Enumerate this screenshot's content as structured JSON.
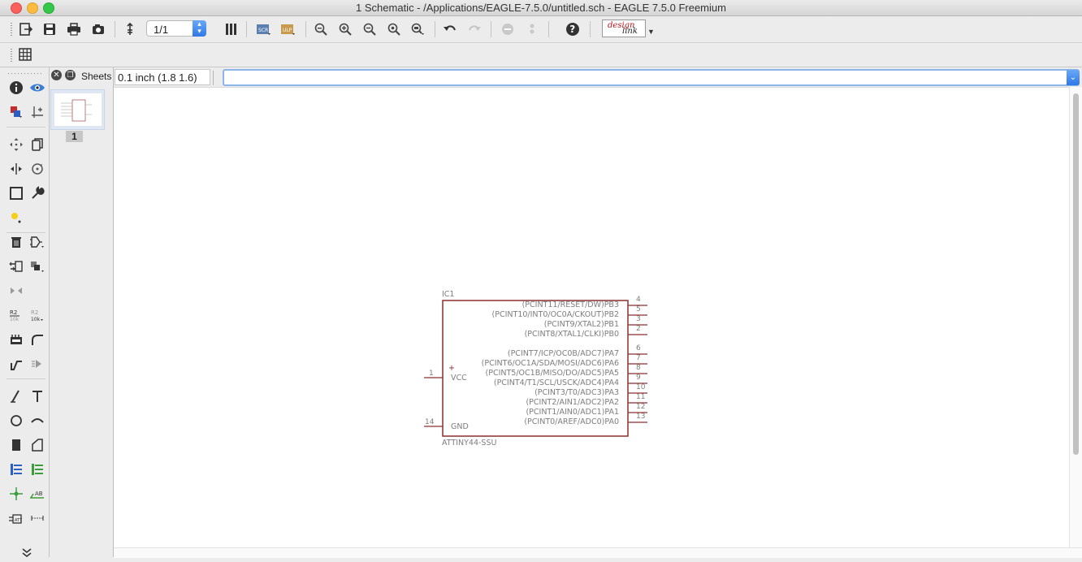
{
  "window": {
    "title": "1 Schematic - /Applications/EAGLE-7.5.0/untitled.sch - EAGLE 7.5.0 Freemium"
  },
  "toolbar": {
    "sheet_select_value": "1/1",
    "designlink_line1": "design",
    "designlink_line2": "link"
  },
  "sheets_panel": {
    "label": "Sheets",
    "sheets": [
      {
        "number": "1"
      }
    ]
  },
  "coordinate_display": "0.1 inch (1.8 1.6)",
  "command_line": {
    "value": ""
  },
  "part": {
    "name": "IC1",
    "value": "ATTINY44-SSU",
    "left_pins": [
      {
        "num": "1",
        "name": "VCC"
      },
      {
        "num": "14",
        "name": "GND"
      }
    ],
    "right_pins": [
      {
        "num": "4",
        "name": "(PCINT11/RESET/DW)PB3"
      },
      {
        "num": "5",
        "name": "(PCINT10/INT0/OC0A/CKOUT)PB2"
      },
      {
        "num": "3",
        "name": "(PCINT9/XTAL2)PB1"
      },
      {
        "num": "2",
        "name": "(PCINT8/XTAL1/CLKI)PB0"
      },
      {
        "num": "6",
        "name": "(PCINT7/ICP/OC0B/ADC7)PA7"
      },
      {
        "num": "7",
        "name": "(PCINT6/OC1A/SDA/MOSI/ADC6)PA6"
      },
      {
        "num": "8",
        "name": "(PCINT5/OC1B/MISO/DO/ADC5)PA5"
      },
      {
        "num": "9",
        "name": "(PCINT4/T1/SCL/USCK/ADC4)PA4"
      },
      {
        "num": "10",
        "name": "(PCINT3/T0/ADC3)PA3"
      },
      {
        "num": "11",
        "name": "(PCINT2/AIN1/ADC2)PA2"
      },
      {
        "num": "12",
        "name": "(PCINT1/AIN0/ADC1)PA1"
      },
      {
        "num": "13",
        "name": "(PCINT0/AREF/ADC0)PA0"
      }
    ],
    "vcc_marker": "+"
  },
  "colors": {
    "part_outline": "#8c2f2f",
    "accent_blue": "#2e79e8",
    "text_gray": "#7d7d7d"
  }
}
